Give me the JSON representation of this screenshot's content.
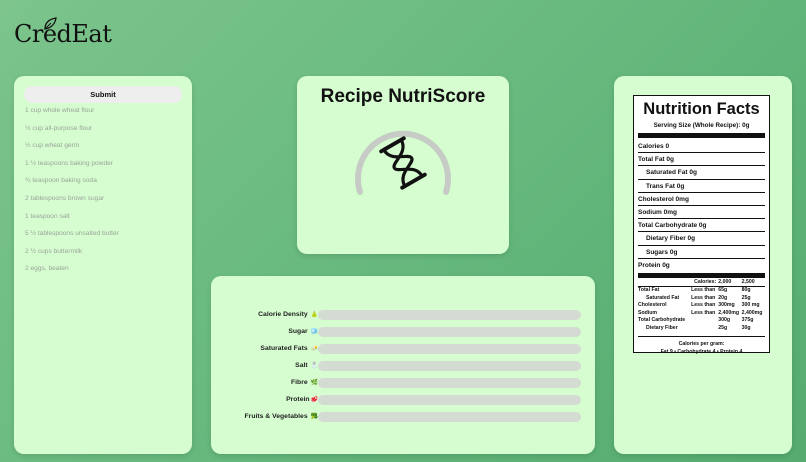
{
  "brand": {
    "logo_text": "CredEat"
  },
  "left_panel": {
    "submit_label": "Submit",
    "ingredients": [
      "1 cup whole wheat flour",
      "½ cup all-purpose flour",
      "½ cup wheat germ",
      "1 ½ teaspoons baking powder",
      "¾ teaspoon baking soda",
      "2 tablespoons brown sugar",
      "1 teaspoon salt",
      "5 ½ tablespoons unsalted butter",
      "2 ½ cups buttermilk",
      "2 eggs, beaten"
    ]
  },
  "score_panel": {
    "title": "Recipe NutriScore",
    "status_icon": "hourglass-icon",
    "gauge_color": "#c6cbc6"
  },
  "nutrients_panel": {
    "rows": [
      {
        "label": "Calorie Density",
        "icon": "🍐",
        "fill": 0
      },
      {
        "label": "Sugar",
        "icon": "🧊",
        "fill": 0
      },
      {
        "label": "Saturated Fats",
        "icon": "🧈",
        "fill": 0
      },
      {
        "label": "Salt",
        "icon": "🧂",
        "fill": 0
      },
      {
        "label": "Fibre",
        "icon": "🌿",
        "fill": 0
      },
      {
        "label": "Protein",
        "icon": "🥩",
        "fill": 0
      },
      {
        "label": "Fruits & Vegetables",
        "icon": "🥦",
        "fill": 0
      }
    ]
  },
  "nutrition_facts": {
    "title": "Nutrition Facts",
    "serving": "Serving Size (Whole Recipe): 0g",
    "calories": "Calories 0",
    "total_fat": "Total Fat 0g",
    "saturated_fat": "Saturated Fat 0g",
    "trans_fat": "Trans Fat 0g",
    "cholesterol": "Cholesterol 0mg",
    "sodium": "Sodium 0mg",
    "total_carb": "Total Carbohydrate 0g",
    "dietary_fiber": "Dietary Fiber 0g",
    "sugars": "Sugars 0g",
    "protein": "Protein 0g",
    "dv_header": [
      "",
      "Calories:",
      "2,000",
      "2,500"
    ],
    "dv_rows": [
      [
        "Total Fat",
        "Less than",
        "65g",
        "80g"
      ],
      [
        "Saturated Fat",
        "Less than",
        "20g",
        "25g"
      ],
      [
        "Cholesterol",
        "Less than",
        "300mg",
        "300 mg"
      ],
      [
        "Sodium",
        "Less than",
        "2,400mg",
        "2,400mg"
      ],
      [
        "Total Carbohydrate",
        "",
        "300g",
        "375g"
      ],
      [
        "Dietary Fiber",
        "",
        "25g",
        "30g"
      ]
    ],
    "calories_per_gram_label": "Calories per gram:",
    "calories_per_gram_values": "Fat 9 • Carbohydrate 4 • Protein 4"
  }
}
